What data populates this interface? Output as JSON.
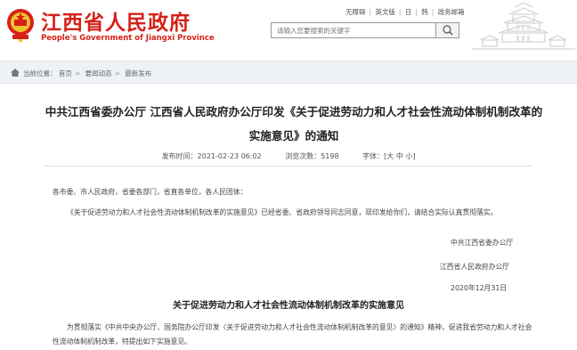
{
  "header": {
    "site_title": "江西省人民政府",
    "site_subtitle": "People's Government of Jiangxi Province",
    "links": [
      "无障碍",
      "英文版",
      "日",
      "韩",
      "政务邮箱"
    ],
    "search_placeholder": "请输入您要搜索的关键字",
    "emblem_color": "#d62118"
  },
  "breadcrumb": {
    "items": [
      "当前位置：",
      "首页",
      "要闻动态",
      "最新发布"
    ]
  },
  "article": {
    "title": "中共江西省委办公厅 江西省人民政府办公厅印发《关于促进劳动力和人才社会性流动体制机制改革的实施意见》的通知",
    "publish_time": "发布时间：2021-02-23 06:02",
    "views": "浏览次数：5198",
    "font_size": "字体：[大 中 小]",
    "paragraph1": "各市委、市人民政府，省委各部门，省直各单位，各人民团体：",
    "paragraph2": "《关于促进劳动力和人才社会性流动体制机制改革的实施意见》已经省委、省政府领导同志同意，现印发给你们，请结合实际认真贯彻落实。",
    "signature1": "中共江西省委办公厅",
    "signature2": "江西省人民政府办公厅",
    "signature_date": "2020年12月31日",
    "subtitle": "关于促进劳动力和人才社会性流动体制机制改革的实施意见",
    "paragraph3": "为贯彻落实《中共中央办公厅、国务院办公厅印发〈关于促进劳动力和人才社会性流动体制机制改革的意见〉的通知》精神，促进我省劳动力和人才社会性流动体制机制改革，特提出如下实施意见。"
  }
}
